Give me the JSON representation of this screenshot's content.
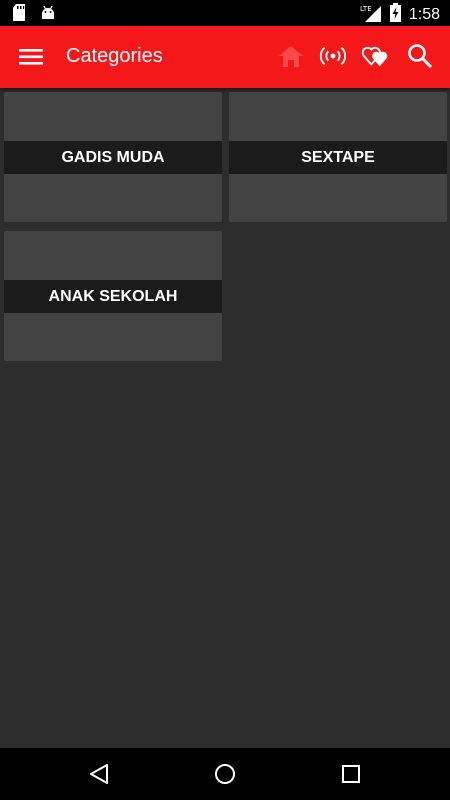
{
  "status_bar": {
    "time": "1:58",
    "network": "LTE",
    "left_icons": [
      "sd-card-icon",
      "android-icon"
    ],
    "right_icons": [
      "lte-signal-icon",
      "battery-charging-icon"
    ]
  },
  "toolbar": {
    "title": "Categories",
    "color": "#f4181b",
    "icons": [
      "home-icon",
      "radio-broadcast-icon",
      "hearts-icon",
      "search-icon"
    ]
  },
  "categories": [
    {
      "label": "GADIS MUDA"
    },
    {
      "label": "SEXTAPE"
    },
    {
      "label": "ANAK SEKOLAH"
    }
  ],
  "nav_bar": {
    "buttons": [
      "back-icon",
      "home-circle-icon",
      "recents-icon"
    ]
  }
}
